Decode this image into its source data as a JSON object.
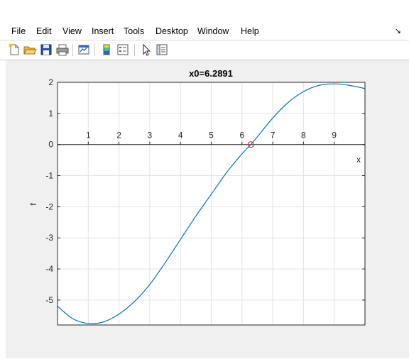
{
  "menu": {
    "items": [
      "File",
      "Edit",
      "View",
      "Insert",
      "Tools",
      "Desktop",
      "Window",
      "Help"
    ]
  },
  "toolbar": {
    "tools": [
      "new-figure-icon",
      "open-file-icon",
      "save-icon",
      "print-icon",
      "link-plot-icon",
      "insert-colorbar-icon",
      "insert-legend-icon",
      "edit-plot-icon",
      "property-inspector-icon"
    ]
  },
  "colors": {
    "line": "#0072bd",
    "marker": "#e03030",
    "grid": "#e3e3e3",
    "figure_background": "#f0f0f0",
    "axes_background": "#ffffff"
  },
  "chart_data": {
    "type": "line",
    "title": "x0=6.2891",
    "xlabel": "x",
    "ylabel": "f",
    "xlim": [
      0,
      10
    ],
    "ylim": [
      -5.8,
      2
    ],
    "x_axis_location": "origin",
    "grid": true,
    "xticks": [
      1,
      2,
      3,
      4,
      5,
      6,
      7,
      8,
      9
    ],
    "yticks": [
      -5,
      -4,
      -3,
      -2,
      -1,
      0,
      1,
      2
    ],
    "series": [
      {
        "x": [
          0,
          0.5,
          1.0,
          1.5,
          2.0,
          2.5,
          3.0,
          3.5,
          4.0,
          4.5,
          5.0,
          5.5,
          6.0,
          6.2891,
          6.5,
          7.0,
          7.5,
          8.0,
          8.5,
          9.0,
          9.5,
          10.0
        ],
        "y": [
          -5.2,
          -5.6,
          -5.75,
          -5.7,
          -5.45,
          -5.05,
          -4.5,
          -3.8,
          -3.05,
          -2.3,
          -1.6,
          -0.9,
          -0.3,
          0.0,
          0.25,
          0.85,
          1.35,
          1.7,
          1.9,
          1.95,
          1.9,
          1.8
        ]
      }
    ],
    "root_marker": {
      "x": 6.2891,
      "y": 0
    }
  }
}
